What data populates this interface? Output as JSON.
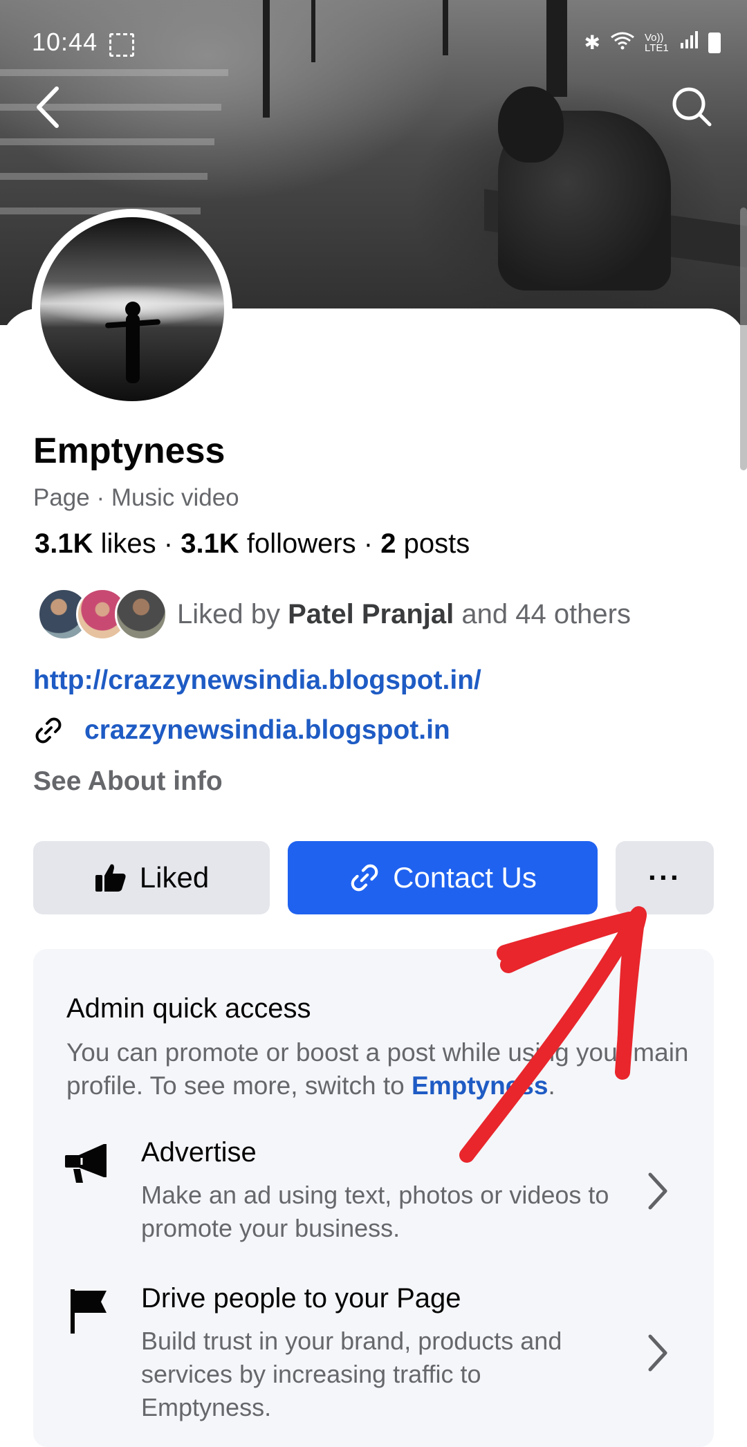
{
  "status_bar": {
    "time": "10:44",
    "network": "Vo)) LTE1"
  },
  "header": {
    "back": "back",
    "search": "search"
  },
  "profile": {
    "name": "Emptyness",
    "category": "Page · Music video",
    "likes_count": "3.1K",
    "likes_label": "likes",
    "followers_count": "3.1K",
    "followers_label": "followers",
    "posts_count": "2",
    "posts_label": "posts",
    "separator": " · ",
    "liked_by_prefix": "Liked by",
    "liked_by_name": "Patel Pranjal",
    "liked_by_suffix": "and 44 others",
    "website_url": "http://crazzynewsindia.blogspot.in/",
    "website_link": "crazzynewsindia.blogspot.in",
    "see_about": "See About info"
  },
  "actions": {
    "liked_label": "Liked",
    "contact_label": "Contact Us",
    "more_label": "···"
  },
  "admin": {
    "title": "Admin quick access",
    "desc_part1": "You can promote or boost a post while using your main profile. To see more, switch to ",
    "desc_link": "Emptyness",
    "desc_end": ".",
    "items": [
      {
        "title": "Advertise",
        "desc": "Make an ad using text, photos or videos to promote your business.",
        "icon": "megaphone-icon"
      },
      {
        "title": "Drive people to your Page",
        "desc": "Build trust in your brand, products and services by increasing traffic to Emptyness.",
        "icon": "flag-icon"
      }
    ]
  },
  "colors": {
    "accent": "#1f62f0",
    "link": "#1e5bc4",
    "annotation": "#e8262c"
  }
}
